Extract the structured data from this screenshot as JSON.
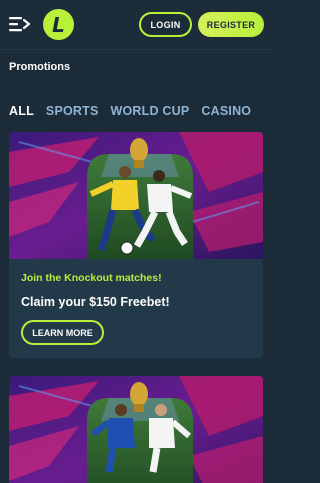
{
  "header": {
    "menu_icon": "menu-arrow-icon",
    "logo_letter": "L",
    "login_label": "LOGIN",
    "register_label": "REGISTER"
  },
  "page": {
    "title": "Promotions"
  },
  "tabs": [
    {
      "label": "ALL",
      "active": true
    },
    {
      "label": "SPORTS",
      "active": false
    },
    {
      "label": "WORLD CUP",
      "active": false
    },
    {
      "label": "CASINO",
      "active": false
    }
  ],
  "promotions": [
    {
      "subtitle": "Join the Knockout matches!",
      "title": "Claim your $150 Freebet!",
      "button_label": "LEARN MORE"
    },
    {
      "subtitle": "",
      "title": "",
      "button_label": ""
    }
  ],
  "colors": {
    "background": "#1b2b38",
    "card": "#22394a",
    "accent": "#b8f03a",
    "tab_inactive": "#8fb4d6",
    "banner_primary": "#5a1a8c",
    "banner_secondary": "#d21e6e"
  }
}
